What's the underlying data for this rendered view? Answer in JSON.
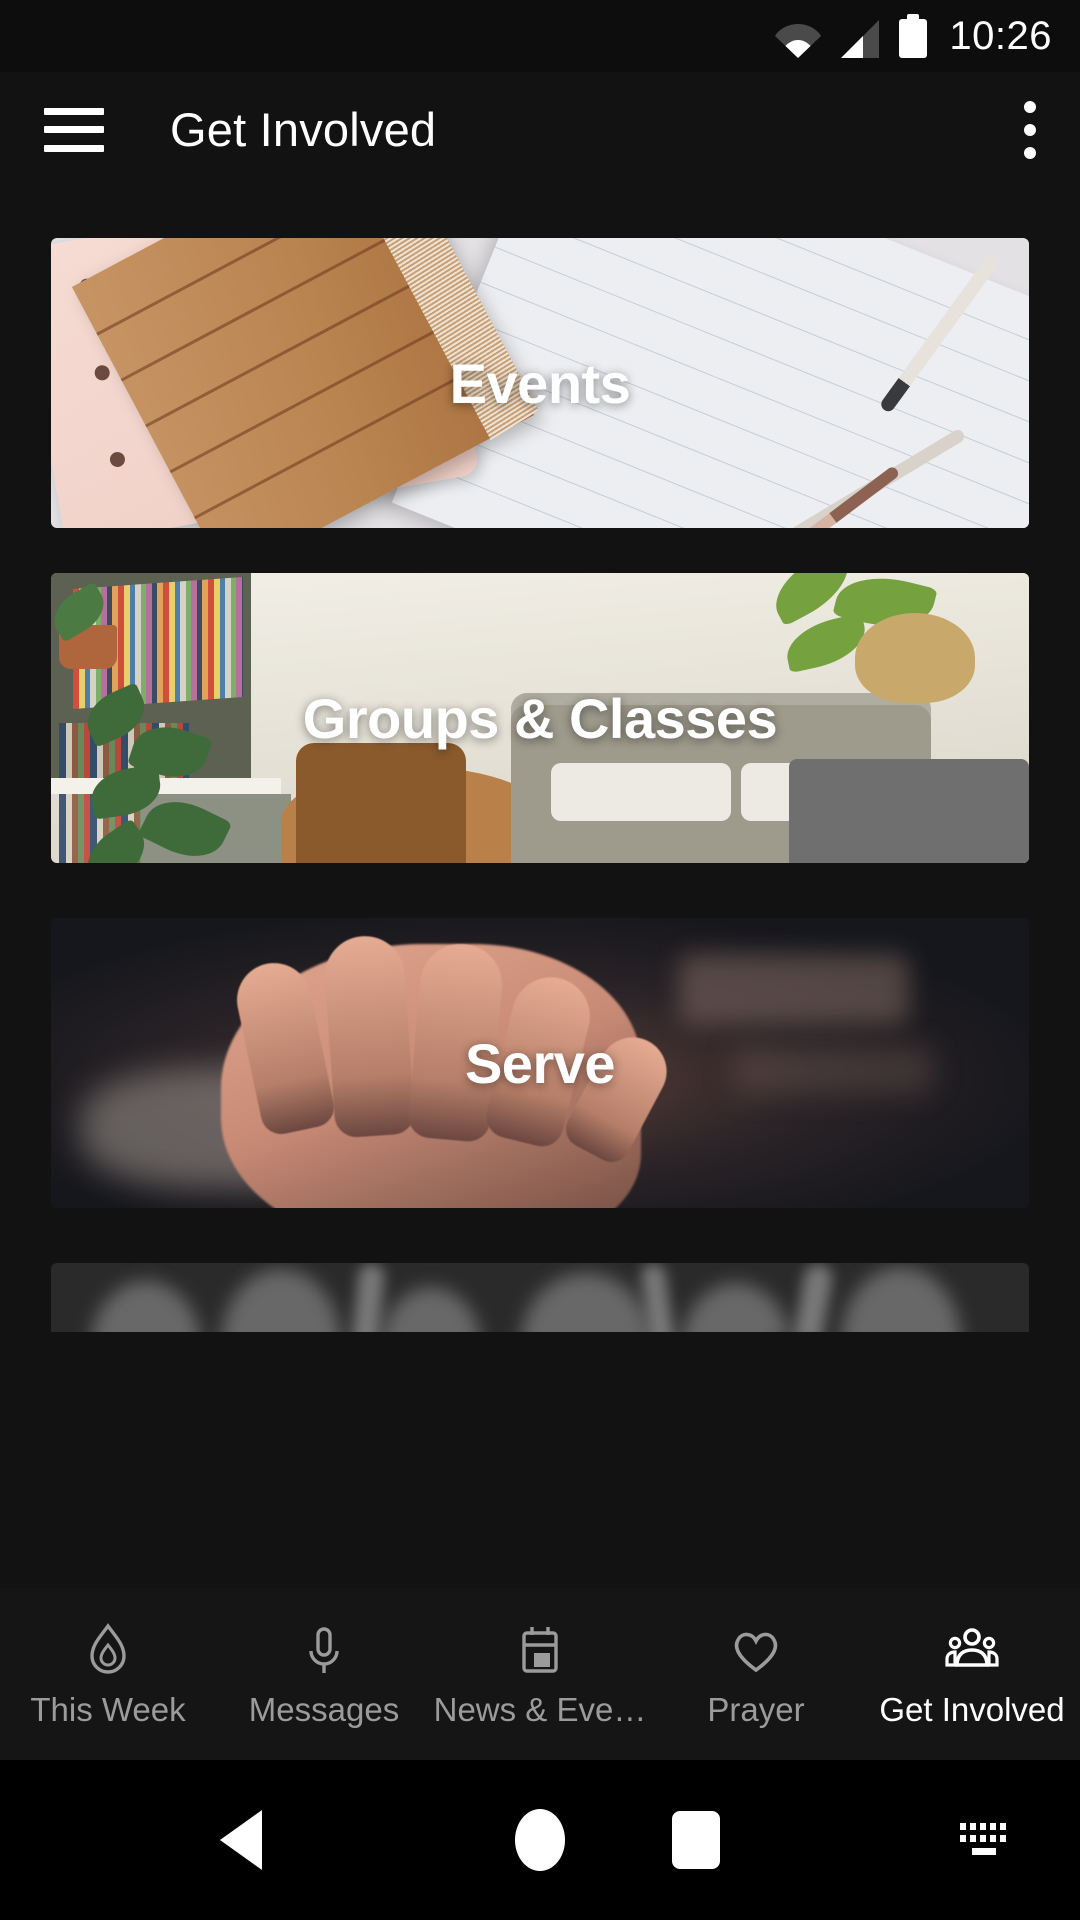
{
  "status_bar": {
    "time": "10:26",
    "icons": [
      "wifi-icon",
      "cellular-signal-icon",
      "battery-icon"
    ]
  },
  "app_bar": {
    "menu_icon": "hamburger-menu-icon",
    "title": "Get Involved",
    "overflow_icon": "more-vertical-icon"
  },
  "cards": [
    {
      "label": "Events",
      "image_description": "notebooks and pens on a desk"
    },
    {
      "label": "Groups & Classes",
      "image_description": "living room with sofa, plants and bookshelves"
    },
    {
      "label": "Serve",
      "image_description": "open palm of a hand in dim light"
    },
    {
      "label": "",
      "image_description": "dark grayscale crowd with raised hands"
    }
  ],
  "bottom_nav": {
    "items": [
      {
        "label": "This Week",
        "icon": "flame-icon",
        "active": false
      },
      {
        "label": "Messages",
        "icon": "microphone-icon",
        "active": false
      },
      {
        "label": "News & Eve…",
        "icon": "calendar-icon",
        "active": false
      },
      {
        "label": "Prayer",
        "icon": "heart-icon",
        "active": false
      },
      {
        "label": "Get Involved",
        "icon": "group-people-icon",
        "active": true
      }
    ]
  },
  "system_nav": {
    "back": "back-triangle-icon",
    "home": "home-circle-icon",
    "recents": "recents-square-icon",
    "keyboard": "keyboard-icon"
  },
  "colors": {
    "background": "#121212",
    "status_bar": "#0d0d0d",
    "bottom_nav": "#151515",
    "active_tab": "#ffffff",
    "inactive_tab": "#9b9b9b",
    "system_nav": "#000000"
  }
}
